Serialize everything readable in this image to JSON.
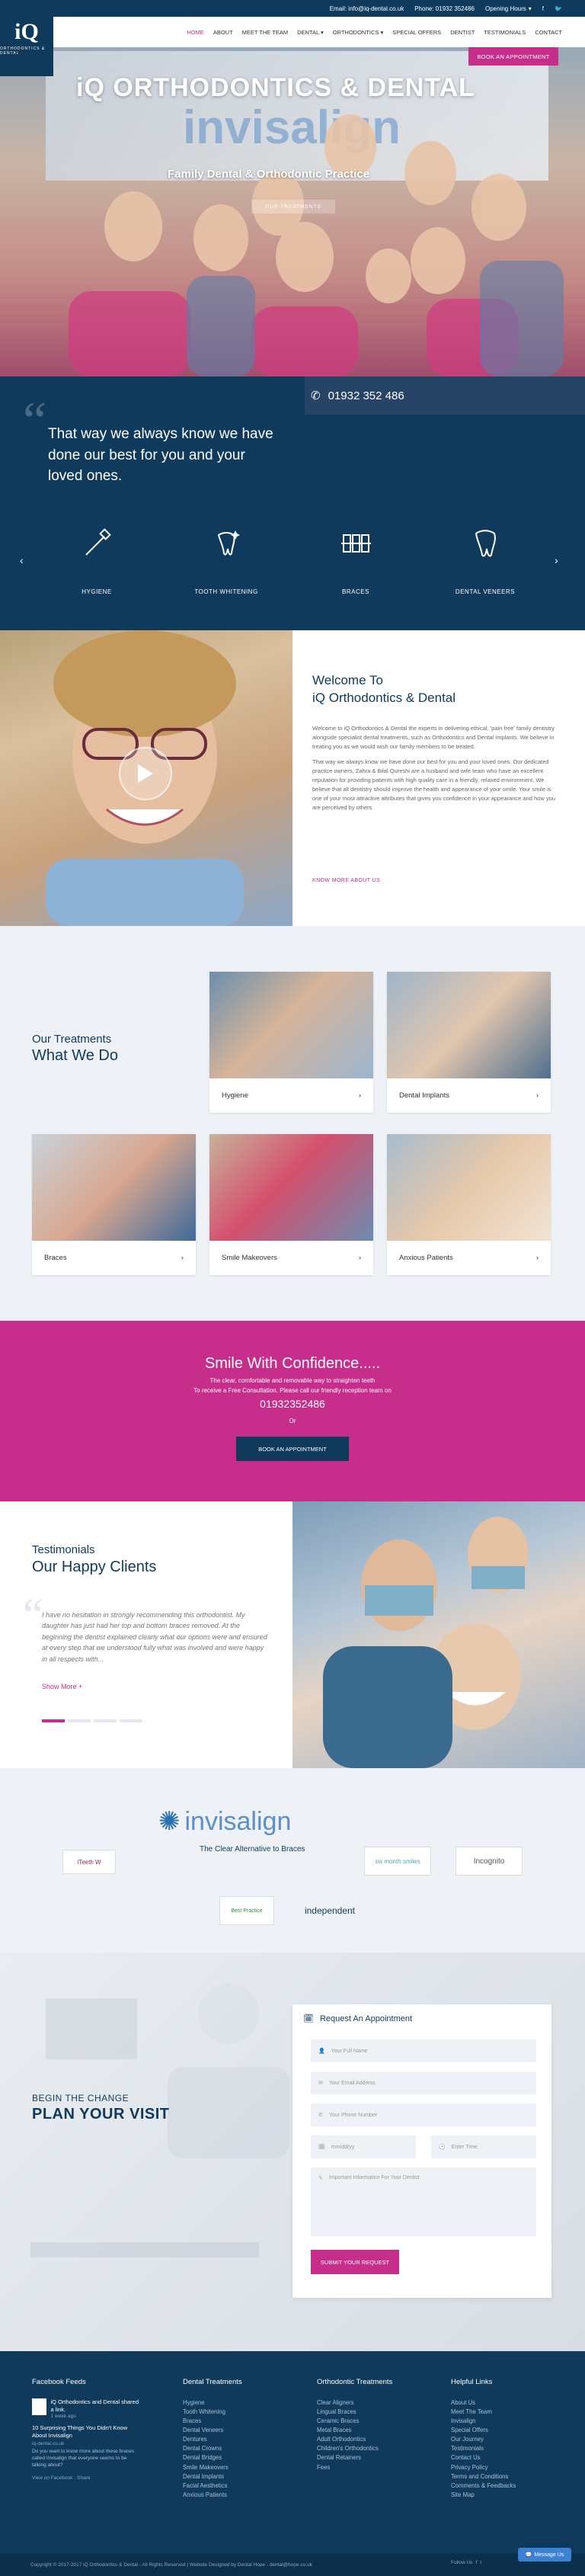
{
  "topbar": {
    "email": "Email: info@iq-dental.co.uk",
    "phone": "Phone: 01932 352486",
    "hours": "Opening Hours"
  },
  "logo": {
    "mark": "iQ",
    "text": "ORTHODONTICS & DENTAL"
  },
  "nav": {
    "items": [
      "HOME",
      "ABOUT",
      "MEET THE TEAM",
      "DENTAL",
      "ORTHODONTICS",
      "SPECIAL OFFERS",
      "DENTIST",
      "TESTIMONIALS",
      "CONTACT"
    ],
    "book": "BOOK AN APPOINTMENT"
  },
  "hero": {
    "sign": "iQ ORTHODONTICS & DENTAL",
    "brand": "invisalign",
    "subtitle": "Family Dental & Orthodontic Practice",
    "tag": "OUR TREATMENTS"
  },
  "phone_banner": "01932 352 486",
  "quote": "That way we always know we have done our best for you and your loved ones.",
  "services": [
    "HYGIENE",
    "TOOTH WHITENING",
    "BRACES",
    "DENTAL VENEERS"
  ],
  "welcome": {
    "title_line1": "Welcome To",
    "title_line2": "iQ Orthodontics & Dental",
    "para1": "Welcome to iQ Orthodontics & Dental the experts in delivering ethical, 'pain free' family dentistry alongside specialist dental treatments, such as Orthodontics and Dental Implants. We believe in treating you as we would wish our family members to be treated.",
    "para2": "That way we always know we have done our best for you and your loved ones. Our dedicated practice owners, Zahra & Bilal Qureshi are a husband and wife team who have an excellent reputation for providing patients with high quality care in a friendly, relaxed environment. We believe that all dentistry should improve the health and appearance of your smile. Your smile is one of your most attractive attributes that gives you confidence in your appearance and how you are perceived by others.",
    "link": "KNOW MORE ABOUT US"
  },
  "treatments": {
    "heading_small": "Our Treatments",
    "heading_big": "What We Do",
    "cards": [
      "Hygiene",
      "Dental Implants",
      "Braces",
      "Smile Makeovers",
      "Anxious Patients"
    ]
  },
  "cta": {
    "title": "Smile With Confidence.....",
    "line1": "The clear, comfortable and removable way to straighten teeth",
    "line2": "To receive a Free Consultation. Please call our friendly reception team on",
    "phone": "01932352486",
    "or": "Or",
    "button": "BOOK AN APPOINTMENT"
  },
  "testimonials": {
    "small": "Testimonials",
    "big": "Our Happy Clients",
    "text": "I have no hesitation in strongly recommending this orthodontist. My daughter has just had her top and bottom braces removed. At the beginning the dentist explained clearly what our options were and ensured at every step that we understood fully what was involved and were happy in all respects with...",
    "more": "Show More +"
  },
  "logos": {
    "invisalign": "invisalign",
    "invisalign_tag": "The Clear Alternative to Braces",
    "others": [
      "iTeeth W",
      "six month smiles",
      "Incognito",
      "Best Practice",
      "independent"
    ]
  },
  "appointment": {
    "small": "BEGIN THE CHANGE",
    "big": "PLAN YOUR VISIT",
    "form_title": "Request An Appointment",
    "name": "Your Full Name",
    "email": "Your Email Address",
    "phone": "Your Phone Number",
    "date": "mm/dd/yy",
    "time": "Enter Time",
    "message": "Important Information For Your Dentist",
    "submit": "SUBMIT YOUR REQUEST"
  },
  "footer": {
    "col1_title": "Facebook Feeds",
    "fb_post1": "iQ Orthodontics and Dental shared a link.",
    "fb_post1_date": "1 week ago",
    "fb_post2": "10 Surprising Things You Didn't Know About Invisalign",
    "fb_post2_site": "iq-dental.co.uk",
    "fb_post2_text": "Do you want to know more about these braces called Invisalign that everyone seems to be talking about?",
    "fb_view": "View on Facebook · Share",
    "col2_title": "Dental Treatments",
    "col2": [
      "Hygiene",
      "Tooth Whitening",
      "Braces",
      "Dental Veneers",
      "Dentures",
      "Dental Crowns",
      "Dental Bridges",
      "Smile Makeovers",
      "Dental Implants",
      "Facial Aesthetics",
      "Anxious Patients"
    ],
    "col3_title": "Orthodontic Treatments",
    "col3": [
      "Clear Aligners",
      "Lingual Braces",
      "Ceramic Braces",
      "Metal Braces",
      "Adult Orthodontics",
      "Children's Orthodontics",
      "Dental Retainers",
      "Fees"
    ],
    "col4_title": "Helpful Links",
    "col4": [
      "About Us",
      "Meet The Team",
      "Invisalign",
      "Special Offers",
      "Our Journey",
      "Testimonials",
      "Contact Us",
      "Privacy Policy",
      "Terms and Conditions",
      "Comments & Feedbacks",
      "Site Map"
    ],
    "copyright": "Copyright © 2017-2017 iQ Orthodontics & Dental - All Rights Reserved | Website Designed by Dental Hope - dental@hope.co.uk",
    "follow": "Follow Us",
    "messenger": "Message Us"
  },
  "colors": {
    "navy": "#0f3a5c",
    "magenta": "#c72e8b",
    "light": "#eef2f6"
  }
}
